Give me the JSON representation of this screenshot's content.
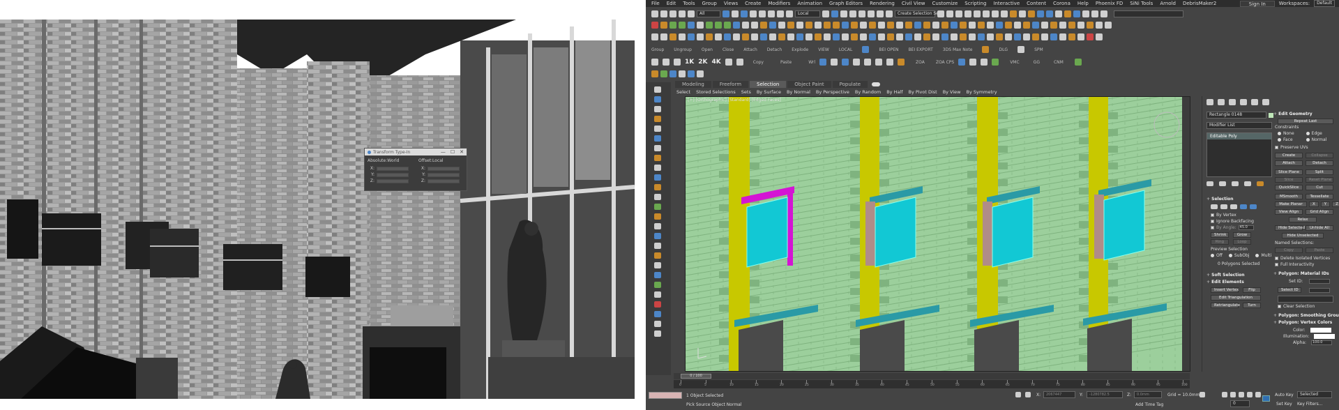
{
  "transform_type_in": {
    "title": "Transform Type-In",
    "absolute_header": "Absolute:World",
    "offset_header": "Offset:Local",
    "axes": [
      "X:",
      "Y:",
      "Z:"
    ],
    "controls": [
      "—",
      "☐",
      "✕"
    ]
  },
  "menubar": {
    "items": [
      "File",
      "Edit",
      "Tools",
      "Group",
      "Views",
      "Create",
      "Modifiers",
      "Animation",
      "Graph Editors",
      "Rendering",
      "Civil View",
      "Customize",
      "Scripting",
      "Interactive",
      "Content",
      "Corona",
      "Help",
      "Phoenix FD",
      "SiNi Tools",
      "Arnold",
      "DebrisMaker2"
    ],
    "sign_in": "Sign In",
    "workspaces_label": "Workspaces:",
    "workspace_value": "Default"
  },
  "main_toolbar": {
    "filter_value": "All",
    "coord_value": "Local",
    "named_selection_placeholder": "Create Selection Se"
  },
  "quick_toolbar": {
    "buttons": [
      "Group",
      "Ungroup",
      "Open",
      "Close",
      "Attach",
      "Detach",
      "Explode",
      "VIEW",
      "LOCAL",
      "BEI OPEN",
      "BEI EXPORT",
      "3DS Max Note",
      "DLG",
      "SPM"
    ]
  },
  "res_toolbar": {
    "buttons": [
      "1K",
      "2K",
      "4K",
      "Copy",
      "Paste",
      "Wrl",
      "ZOA",
      "ZOA CPS",
      "VMC",
      "GG",
      "CNM"
    ]
  },
  "ribbon": {
    "tabs": [
      "Modeling",
      "Freeform",
      "Selection",
      "Object Paint",
      "Populate"
    ],
    "active_tab": "Selection",
    "selection_items": [
      "Select",
      "Stored Selections",
      "Sets",
      "By Surface",
      "By Normal",
      "By Perspective",
      "By Random",
      "By Half",
      "By Pivot Dist",
      "By View",
      "By Symmetry"
    ]
  },
  "viewport": {
    "label": "[+] [Orthographic] [Standard] [Edged Faces]",
    "colors": {
      "wall": "#9ccf9c",
      "brick_line": "#7fb37f",
      "pillar": "#c8c800",
      "glass": "#12c8d4",
      "frame": "#b08c88",
      "sill": "#2a9aa6",
      "selected": "#d414d4",
      "dark": "#4a4a4a"
    }
  },
  "command_panel": {
    "object_name": "Rectangle 0148",
    "modifier_list": "Modifier List",
    "stack_item": "Editable Poly",
    "selection": {
      "title": "Selection",
      "by_vertex": "By Vertex",
      "ignore_backfacing": "Ignore Backfacing",
      "by_angle": "By Angle:",
      "by_angle_value": "45.0",
      "shrink": "Shrink",
      "grow": "Grow",
      "ring": "Ring",
      "loop": "Loop",
      "preview_selection": "Preview Selection",
      "off": "Off",
      "subobj": "SubObj",
      "multi": "Multi",
      "status": "0 Polygons Selected"
    },
    "soft_selection": "Soft Selection",
    "edit_elements": {
      "title": "Edit Elements",
      "insert_vertex": "Insert Vertex",
      "flip": "Flip",
      "edit_triangulation": "Edit Triangulation",
      "retriangulate": "Retriangulate",
      "turn": "Turn"
    },
    "edit_geometry": {
      "title": "Edit Geometry",
      "repeat_last": "Repeat Last",
      "constraints": "Constraints",
      "none": "None",
      "edge": "Edge",
      "face": "Face",
      "normal": "Normal",
      "preserve_uvs": "Preserve UVs",
      "create": "Create",
      "collapse": "Collapse",
      "attach": "Attach",
      "detach": "Detach",
      "slice_plane": "Slice Plane",
      "split": "Split",
      "slice": "Slice",
      "reset_plane": "Reset Plane",
      "quickslice": "QuickSlice",
      "cut": "Cut",
      "msmooth": "MSmooth",
      "tessellate": "Tessellate",
      "make_planar": "Make Planar",
      "xyz": [
        "X",
        "Y",
        "Z"
      ],
      "view_align": "View Align",
      "grid_align": "Grid Align",
      "relax": "Relax",
      "hide_selected": "Hide Selected",
      "unhide_all": "Unhide All",
      "hide_unselected": "Hide Unselected",
      "named_selections": "Named Selections:",
      "copy": "Copy",
      "paste": "Paste",
      "delete_isolated": "Delete Isolated Vertices",
      "full_interactivity": "Full Interactivity"
    },
    "material_ids": {
      "title": "Polygon: Material IDs",
      "set_id": "Set ID:",
      "select_id": "Select ID",
      "clear_selection": "Clear Selection"
    },
    "smoothing_groups": "Polygon: Smoothing Grou",
    "vertex_colors": {
      "title": "Polygon: Vertex Colors",
      "color": "Color:",
      "illumination": "Illumination:",
      "alpha": "Alpha:",
      "alpha_value": "100.0"
    }
  },
  "timeline": {
    "slider": "0 / 100",
    "ticks": [
      "0",
      "5",
      "10",
      "15",
      "20",
      "25",
      "30",
      "35",
      "40",
      "45",
      "50",
      "55",
      "60",
      "65",
      "70",
      "75",
      "80",
      "85",
      "90",
      "95",
      "100"
    ]
  },
  "status_bar": {
    "selection": "1 Object Selected",
    "prompt": "Pick Source Object Normal",
    "x_label": "X:",
    "x_value": "2067447",
    "y_label": "Y:",
    "y_value": "-1280782.5",
    "z_label": "Z:",
    "z_value": "0.0mm",
    "grid": "Grid = 10.0mm",
    "add_time_tag": "Add Time Tag",
    "auto_key": "Auto Key",
    "selected": "Selected",
    "set_key": "Set Key",
    "key_filters": "Key Filters...",
    "frame": "0"
  }
}
